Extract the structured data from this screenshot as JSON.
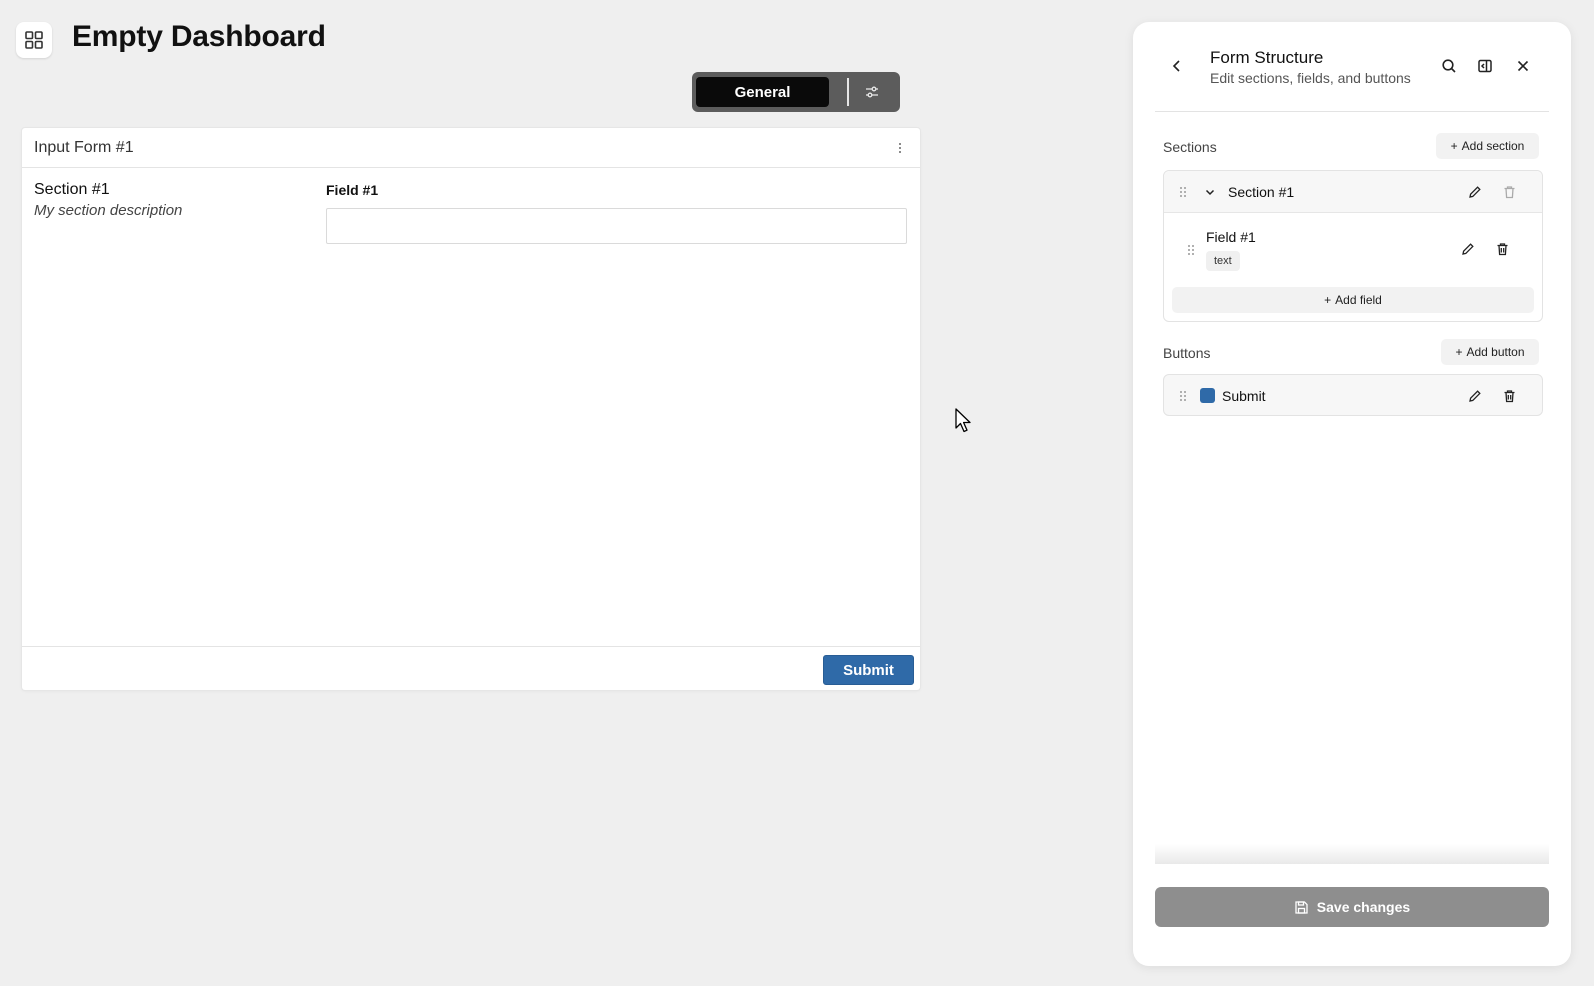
{
  "dashboard": {
    "title": "Empty Dashboard",
    "app_icon": "grid-icon"
  },
  "view_toggle": {
    "active_label": "General",
    "settings_icon": "sliders-icon"
  },
  "form": {
    "title": "Input Form #1",
    "menu_icon": "more-vertical-icon",
    "section": {
      "title": "Section #1",
      "description": "My section description"
    },
    "field": {
      "label": "Field #1",
      "value": ""
    },
    "submit_label": "Submit"
  },
  "panel": {
    "title": "Form Structure",
    "subtitle": "Edit sections, fields, and buttons",
    "icons": [
      "chevron-left-icon",
      "search-icon",
      "split-view-icon",
      "close-icon"
    ],
    "sections_label": "Sections",
    "add_section_label": "Add section",
    "sections": [
      {
        "name": "Section #1",
        "fields": [
          {
            "name": "Field #1",
            "type": "text"
          }
        ]
      }
    ],
    "add_field_label": "Add field",
    "buttons_label": "Buttons",
    "add_button_label": "Add button",
    "buttons": [
      {
        "name": "Submit",
        "color": "#2f6aa8"
      }
    ],
    "save_label": "Save changes"
  },
  "colors": {
    "submit_button": "#2f6aa8",
    "toggle_active": "#0a0a0a",
    "save_button_disabled": "#8e8e8e"
  }
}
